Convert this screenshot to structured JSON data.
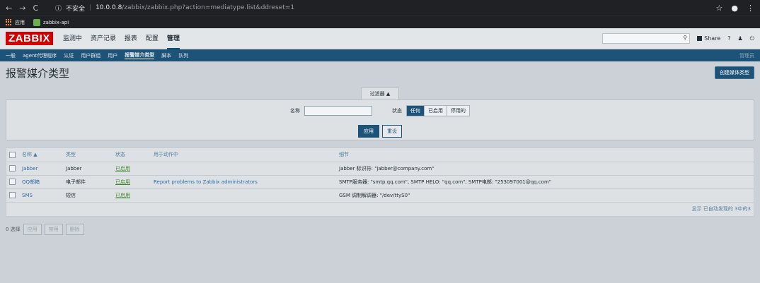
{
  "browser": {
    "nav": {
      "back": "←",
      "forward": "→",
      "reload": "C"
    },
    "security_icon": "ⓘ",
    "security_label": "不安全",
    "url_host": "10.0.0.8",
    "url_path": "/zabbix/zabbix.php?action=mediatype.list&ddreset=1",
    "right_icons": {
      "star": "☆",
      "account": "●",
      "menu": "⋮"
    },
    "bookmarks": [
      "应用",
      "zabbix-api"
    ]
  },
  "header": {
    "logo": "ZABBIX",
    "menu": [
      "监测中",
      "资产记录",
      "报表",
      "配置",
      "管理"
    ],
    "active_menu": "管理",
    "search_icon": "search-icon",
    "search_glyph": "⚲",
    "share_label": "Share",
    "help_glyph": "?",
    "user_glyph": "♟",
    "logout_glyph": "⏻"
  },
  "subnav": {
    "items": [
      "一般",
      "agent代理程序",
      "认证",
      "用户群组",
      "用户",
      "报警媒介类型",
      "脚本",
      "队列"
    ],
    "active": "报警媒介类型",
    "right": "管理员"
  },
  "page": {
    "title": "报警媒介类型",
    "create_button": "创建媒体类型"
  },
  "filter": {
    "tab_label": "过滤器 ▲",
    "name_label": "名称",
    "name_value": "",
    "status_label": "状态",
    "status_options": [
      "任何",
      "已启用",
      "停用的"
    ],
    "status_selected": "任何",
    "apply_label": "应用",
    "reset_label": "重设"
  },
  "table": {
    "headers": {
      "name": "名称 ▲",
      "type": "类型",
      "status": "状态",
      "used": "用于动作中",
      "details": "细节"
    },
    "rows": [
      {
        "name": "Jabber",
        "type": "Jabber",
        "status": "已启用",
        "used": "",
        "details": "Jabber 标识符: \"jabber@company.com\""
      },
      {
        "name": "QQ邮箱",
        "type": "电子邮件",
        "status": "已启用",
        "used": "Report problems to Zabbix administrators",
        "details": "SMTP服务器: \"smtp.qq.com\", SMTP HELO: \"qq.com\", SMTP电邮: \"253097001@qq.com\""
      },
      {
        "name": "SMS",
        "type": "短信",
        "status": "已启用",
        "used": "",
        "details": "GSM 调制解调器: \"/dev/ttyS0\""
      }
    ],
    "footer": "显示 已自动发现的 3中的3"
  },
  "actions": {
    "selected": "0 选择",
    "buttons": [
      "应用",
      "禁用",
      "删除"
    ]
  },
  "colors": {
    "logo": "#d40000",
    "nav_bar": "#1d5279",
    "status_enabled": "#3f8a2e",
    "link": "#2f6ca3"
  }
}
